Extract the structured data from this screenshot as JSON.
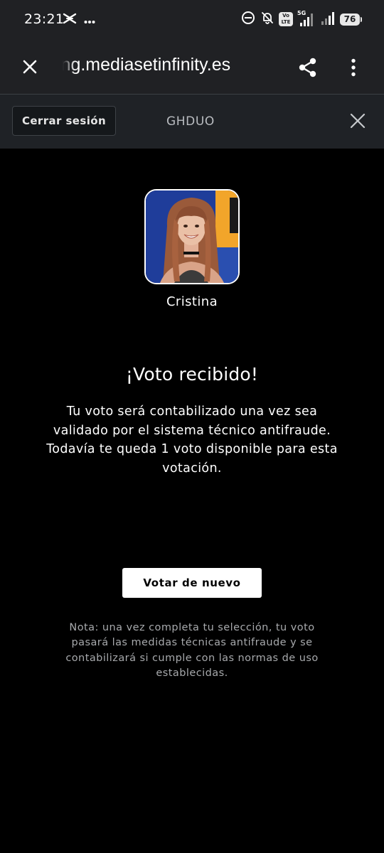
{
  "status_bar": {
    "time": "23:21",
    "left_icons": [
      "capcut-icon",
      "more-dots-icon"
    ],
    "right_icons": [
      "link-icon",
      "bell-off-icon",
      "volte-icon",
      "signal-5g-icon",
      "signal-icon",
      "battery-icon"
    ],
    "volte_top": "Vo",
    "volte_bottom": "LTE",
    "network": "5G",
    "battery": "76"
  },
  "browser": {
    "url": "ing.mediasetinfinity.es",
    "close_icon": "close-icon",
    "share_icon": "share-icon",
    "menu_icon": "more-vert-icon"
  },
  "site_header": {
    "logout_label": "Cerrar sesión",
    "title": "GHDUO",
    "close_icon": "close-icon"
  },
  "candidate": {
    "name": "Cristina",
    "photo_icon": "candidate-photo"
  },
  "confirmation": {
    "title": "¡Voto recibido!",
    "message": "Tu voto será contabilizado una vez sea validado por el sistema técnico antifraude. Todavía te queda 1 voto disponible para esta votación."
  },
  "vote_again_label": "Votar de nuevo",
  "note": "Nota: una vez completa tu selección, tu voto pasará las medidas técnicas antifraude y se contabilizará si cumple con las normas de uso establecidas.",
  "colors": {
    "background": "#000000",
    "chrome_bar": "#202124",
    "site_header": "#1f2226",
    "text_primary": "#ffffff",
    "text_muted": "#a7a9ac",
    "button_bg": "#ffffff"
  }
}
